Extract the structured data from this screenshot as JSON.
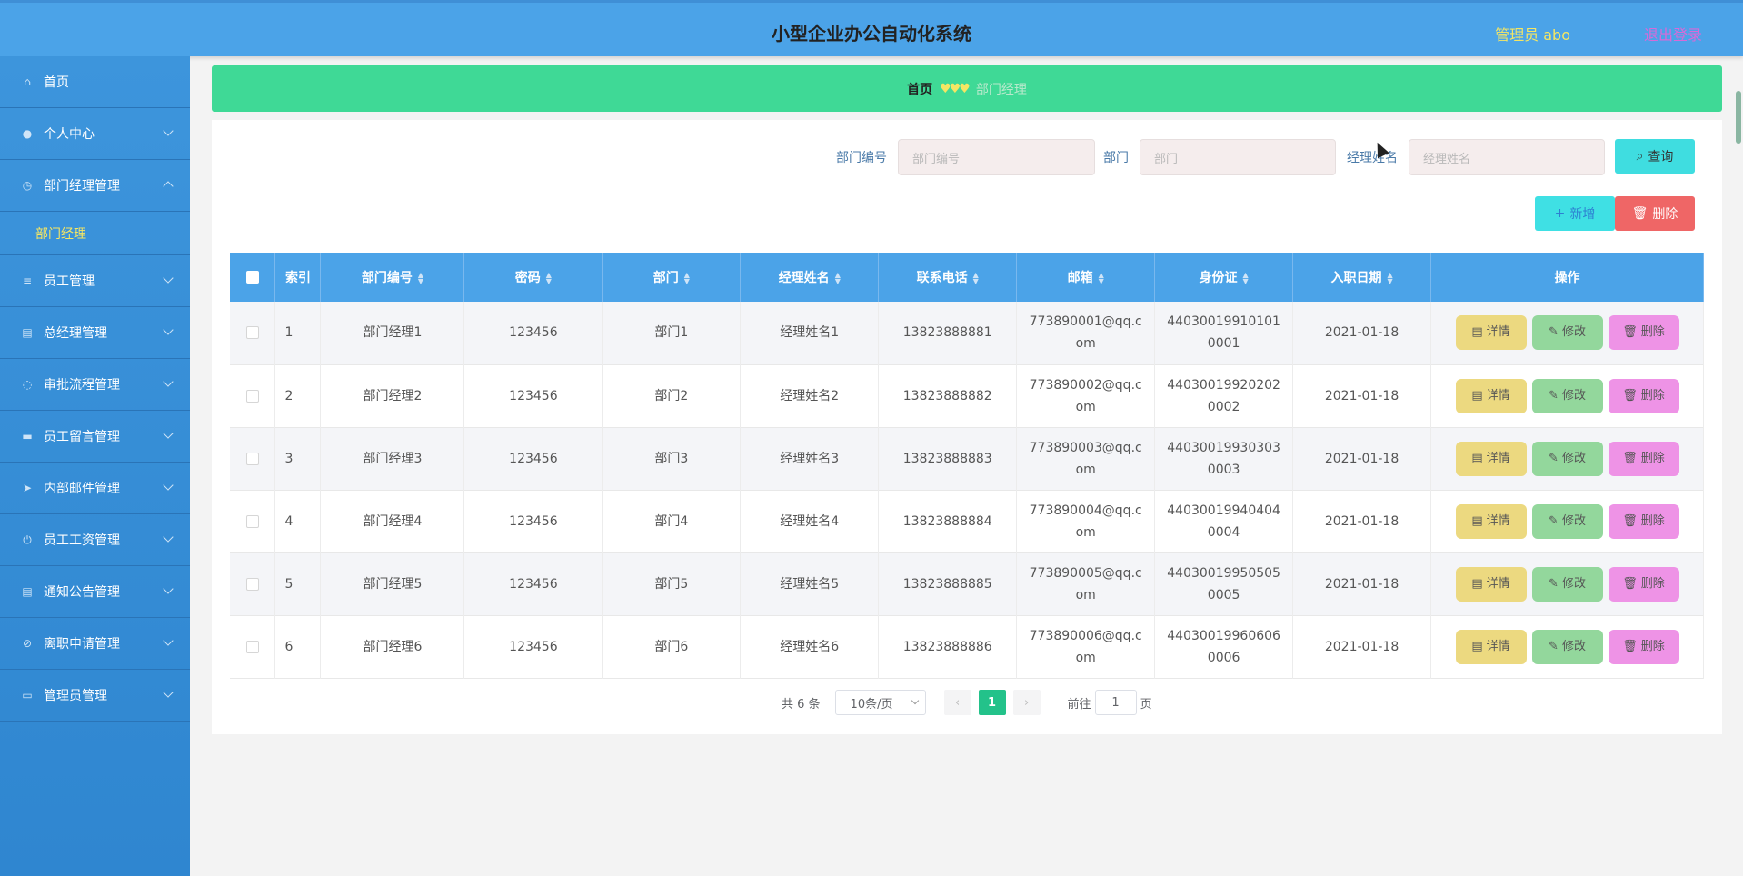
{
  "header": {
    "title": "小型企业办公自动化系统",
    "user": "管理员 abo",
    "logout": "退出登录"
  },
  "sidebar": {
    "items": [
      {
        "label": "首页",
        "icon": "home-icon"
      },
      {
        "label": "个人中心",
        "icon": "user-icon"
      },
      {
        "label": "部门经理管理",
        "icon": "clock-icon",
        "expanded": true,
        "sub": "部门经理"
      },
      {
        "label": "员工管理",
        "icon": "list-icon"
      },
      {
        "label": "总经理管理",
        "icon": "clipboard-icon"
      },
      {
        "label": "审批流程管理",
        "icon": "circle-icon"
      },
      {
        "label": "员工留言管理",
        "icon": "monitor-icon"
      },
      {
        "label": "内部邮件管理",
        "icon": "send-icon"
      },
      {
        "label": "员工工资管理",
        "icon": "power-icon"
      },
      {
        "label": "通知公告管理",
        "icon": "clipboard-icon"
      },
      {
        "label": "离职申请管理",
        "icon": "forbid-icon"
      },
      {
        "label": "管理员管理",
        "icon": "message-icon"
      }
    ]
  },
  "breadcrumb": {
    "home": "首页",
    "separator": "♥♥♥",
    "current": "部门经理"
  },
  "search": {
    "dept_no_label": "部门编号",
    "dept_no_placeholder": "部门编号",
    "dept_label": "部门",
    "dept_placeholder": "部门",
    "manager_label": "经理姓名",
    "manager_placeholder": "经理姓名",
    "query_label": "查询"
  },
  "actions": {
    "add_label": "新增",
    "delete_label": "删除"
  },
  "table": {
    "headers": [
      "索引",
      "部门编号",
      "密码",
      "部门",
      "经理姓名",
      "联系电话",
      "邮箱",
      "身份证",
      "入职日期",
      "操作"
    ],
    "rows": [
      {
        "index": "1",
        "dept_no": "部门经理1",
        "password": "123456",
        "dept": "部门1",
        "manager": "经理姓名1",
        "phone": "13823888881",
        "email": "773890001@qq.com",
        "id_card": "440300199101010001",
        "date": "2021-01-18"
      },
      {
        "index": "2",
        "dept_no": "部门经理2",
        "password": "123456",
        "dept": "部门2",
        "manager": "经理姓名2",
        "phone": "13823888882",
        "email": "773890002@qq.com",
        "id_card": "440300199202020002",
        "date": "2021-01-18"
      },
      {
        "index": "3",
        "dept_no": "部门经理3",
        "password": "123456",
        "dept": "部门3",
        "manager": "经理姓名3",
        "phone": "13823888883",
        "email": "773890003@qq.com",
        "id_card": "440300199303030003",
        "date": "2021-01-18"
      },
      {
        "index": "4",
        "dept_no": "部门经理4",
        "password": "123456",
        "dept": "部门4",
        "manager": "经理姓名4",
        "phone": "13823888884",
        "email": "773890004@qq.com",
        "id_card": "440300199404040004",
        "date": "2021-01-18"
      },
      {
        "index": "5",
        "dept_no": "部门经理5",
        "password": "123456",
        "dept": "部门5",
        "manager": "经理姓名5",
        "phone": "13823888885",
        "email": "773890005@qq.com",
        "id_card": "440300199505050005",
        "date": "2021-01-18"
      },
      {
        "index": "6",
        "dept_no": "部门经理6",
        "password": "123456",
        "dept": "部门6",
        "manager": "经理姓名6",
        "phone": "13823888886",
        "email": "773890006@qq.com",
        "id_card": "440300199606060006",
        "date": "2021-01-18"
      }
    ],
    "row_actions": {
      "detail": "详情",
      "edit": "修改",
      "delete": "删除"
    }
  },
  "pagination": {
    "total": "共 6 条",
    "page_size": "10条/页",
    "current_page": "1",
    "goto_label": "前往",
    "goto_value": "1",
    "page_suffix": "页"
  },
  "colors": {
    "header": "#4ba3e8",
    "sidebar": "#3d95dc",
    "breadcrumb": "#3fd996",
    "accent_yellow": "#f5e663"
  }
}
